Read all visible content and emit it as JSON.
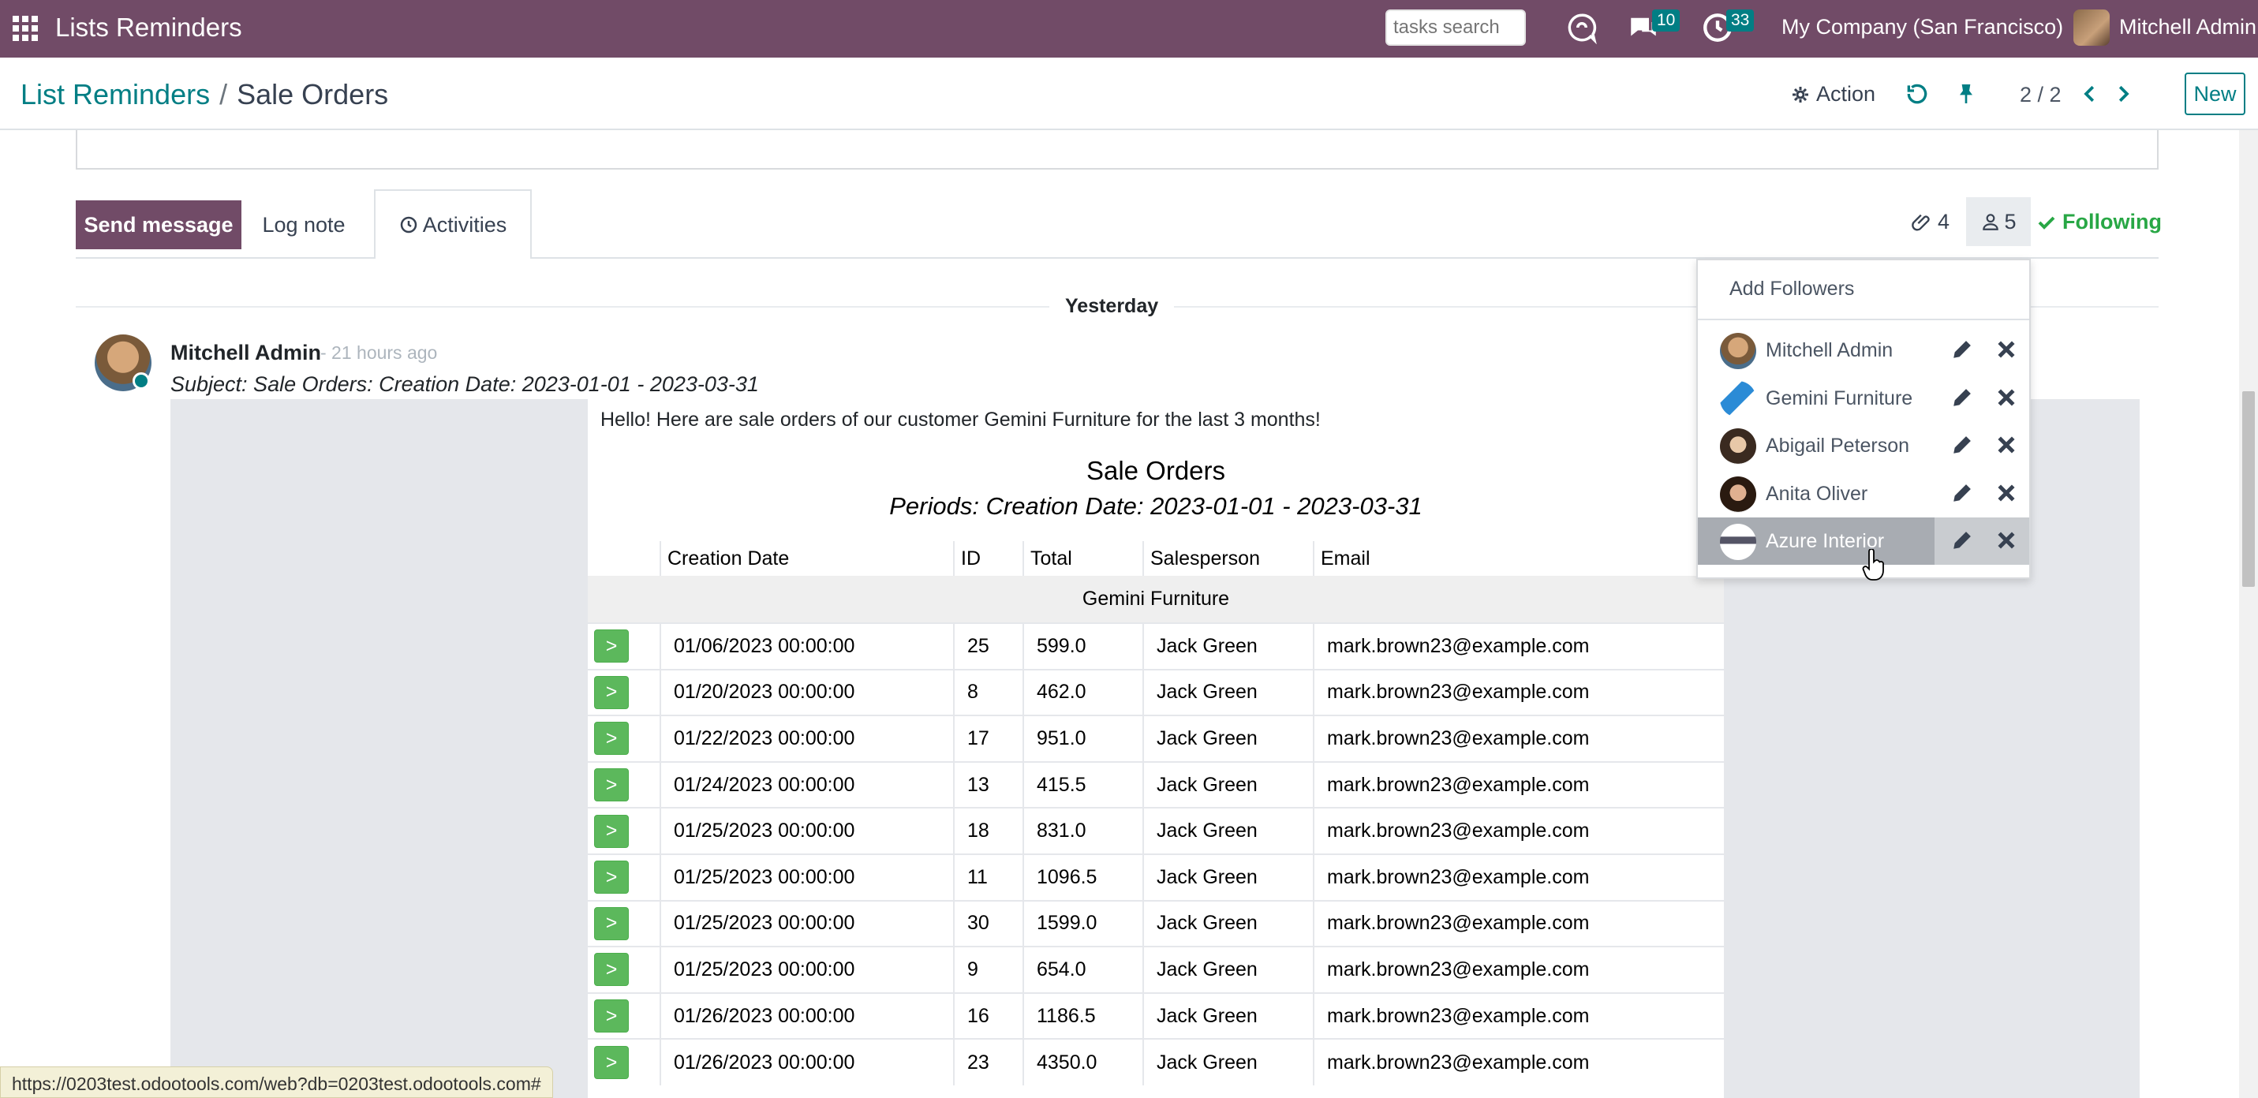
{
  "navbar": {
    "app_title": "Lists Reminders",
    "search_placeholder": "tasks search",
    "messages_count": "10",
    "activities_count": "33",
    "company": "My Company (San Francisco)",
    "user": "Mitchell Admin"
  },
  "control_panel": {
    "breadcrumb_parent": "List Reminders",
    "breadcrumb_separator": "/",
    "breadcrumb_current": "Sale Orders",
    "action_label": "Action",
    "pager": "2 / 2",
    "new_label": "New"
  },
  "chatter": {
    "send_message": "Send message",
    "log_note": "Log note",
    "activities": "Activities",
    "attachments_count": "4",
    "followers_count": "5",
    "following": "Following",
    "day_label": "Yesterday"
  },
  "message": {
    "author": "Mitchell Admin",
    "time": "- 21 hours ago",
    "subject": "Subject: Sale Orders: Creation Date: 2023-01-01 - 2023-03-31",
    "intro": "Hello! Here are sale orders of our customer Gemini Furniture for the last 3 months!",
    "report_title": "Sale Orders",
    "report_period": "Periods: Creation Date: 2023-01-01 - 2023-03-31",
    "columns": [
      "",
      "Creation Date",
      "ID",
      "Total",
      "Salesperson",
      "Email"
    ],
    "group": "Gemini Furniture",
    "open_label": ">",
    "rows": [
      {
        "date": "01/06/2023 00:00:00",
        "id": "25",
        "total": "599.0",
        "salesperson": "Jack Green",
        "email": "mark.brown23@example.com"
      },
      {
        "date": "01/20/2023 00:00:00",
        "id": "8",
        "total": "462.0",
        "salesperson": "Jack Green",
        "email": "mark.brown23@example.com"
      },
      {
        "date": "01/22/2023 00:00:00",
        "id": "17",
        "total": "951.0",
        "salesperson": "Jack Green",
        "email": "mark.brown23@example.com"
      },
      {
        "date": "01/24/2023 00:00:00",
        "id": "13",
        "total": "415.5",
        "salesperson": "Jack Green",
        "email": "mark.brown23@example.com"
      },
      {
        "date": "01/25/2023 00:00:00",
        "id": "18",
        "total": "831.0",
        "salesperson": "Jack Green",
        "email": "mark.brown23@example.com"
      },
      {
        "date": "01/25/2023 00:00:00",
        "id": "11",
        "total": "1096.5",
        "salesperson": "Jack Green",
        "email": "mark.brown23@example.com"
      },
      {
        "date": "01/25/2023 00:00:00",
        "id": "30",
        "total": "1599.0",
        "salesperson": "Jack Green",
        "email": "mark.brown23@example.com"
      },
      {
        "date": "01/25/2023 00:00:00",
        "id": "9",
        "total": "654.0",
        "salesperson": "Jack Green",
        "email": "mark.brown23@example.com"
      },
      {
        "date": "01/26/2023 00:00:00",
        "id": "16",
        "total": "1186.5",
        "salesperson": "Jack Green",
        "email": "mark.brown23@example.com"
      },
      {
        "date": "01/26/2023 00:00:00",
        "id": "23",
        "total": "4350.0",
        "salesperson": "Jack Green",
        "email": "mark.brown23@example.com"
      }
    ]
  },
  "followers_dropdown": {
    "add_followers": "Add Followers",
    "followers": [
      {
        "name": "Mitchell Admin",
        "avatar": "person-photo"
      },
      {
        "name": "Gemini Furniture",
        "avatar": "company-logo"
      },
      {
        "name": "Abigail Peterson",
        "avatar": "person-photo"
      },
      {
        "name": "Anita Oliver",
        "avatar": "person-photo"
      },
      {
        "name": "Azure Interior",
        "avatar": "company-logo"
      }
    ]
  },
  "status_bar": {
    "url": "https://0203test.odootools.com/web?db=0203test.odootools.com#"
  },
  "colors": {
    "brand": "#714b67",
    "accent": "#017e84",
    "success": "#28a745",
    "row_button": "#5cb85c"
  }
}
